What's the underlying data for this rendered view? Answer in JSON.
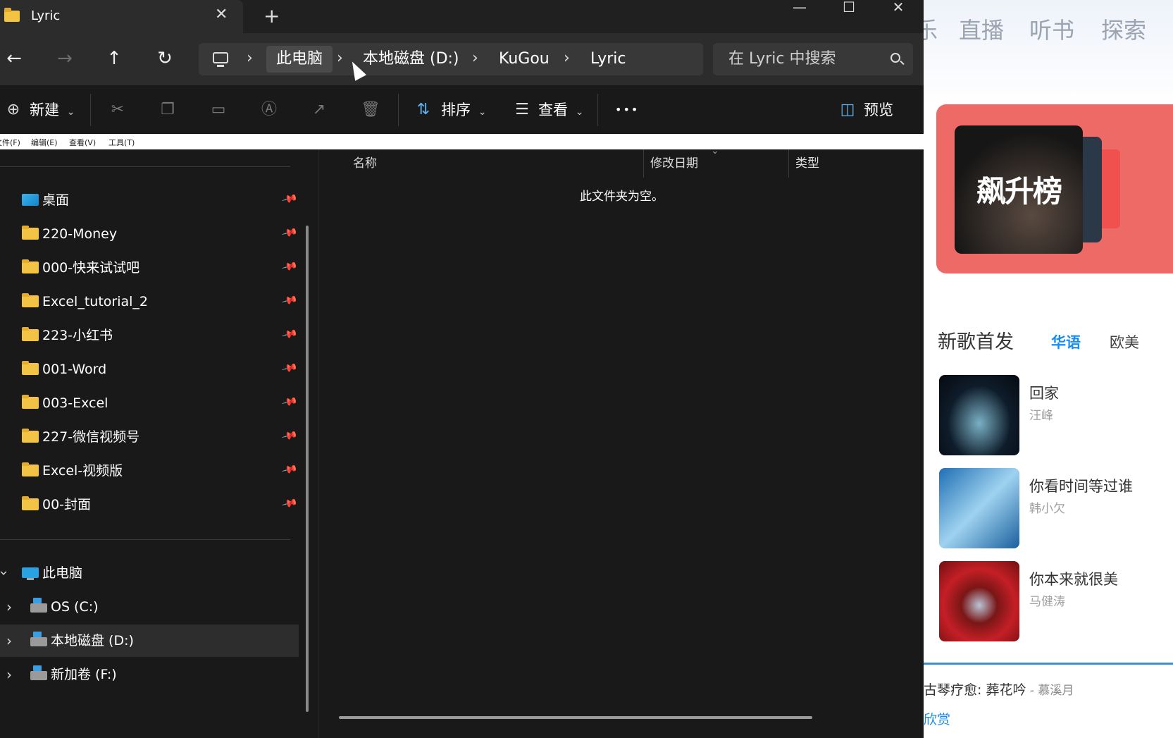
{
  "explorer": {
    "tab_title": "Lyric",
    "tab_close": "✕",
    "tab_add": "+",
    "win_min": "—",
    "win_max": "☐",
    "win_close": "✕",
    "address": {
      "segments": [
        "此电脑",
        "本地磁盘 (D:)",
        "KuGou",
        "Lyric"
      ],
      "chevron": "›"
    },
    "search_placeholder": "在 Lyric 中搜索",
    "nav_icons": {
      "back": "←",
      "forward": "→",
      "up": "↑",
      "refresh": "↻"
    },
    "toolbar": {
      "new_label": "新建",
      "sort_label": "排序",
      "view_label": "查看",
      "more_label": "•••",
      "preview_label": "预览",
      "caret": "⌄"
    },
    "menubar": [
      "文件(F)",
      "编辑(E)",
      "查看(V)",
      "工具(T)"
    ],
    "sidebar": {
      "quick_access": [
        {
          "label": "桌面",
          "icon": "desktop-icon"
        },
        {
          "label": "220-Money",
          "icon": "folder-icon"
        },
        {
          "label": "000-快来试试吧",
          "icon": "folder-icon"
        },
        {
          "label": "Excel_tutorial_2",
          "icon": "folder-icon"
        },
        {
          "label": "223-小红书",
          "icon": "folder-icon"
        },
        {
          "label": "001-Word",
          "icon": "folder-icon"
        },
        {
          "label": "003-Excel",
          "icon": "folder-icon"
        },
        {
          "label": "227-微信视频号",
          "icon": "folder-icon"
        },
        {
          "label": "Excel-视频版",
          "icon": "folder-icon"
        },
        {
          "label": "00-封面",
          "icon": "folder-icon"
        }
      ],
      "this_pc": "此电脑",
      "drives": [
        "OS (C:)",
        "本地磁盘 (D:)",
        "新加卷 (F:)"
      ],
      "pin_glyph": "📌"
    },
    "columns": {
      "name": "名称",
      "modified": "修改日期",
      "type": "类型"
    },
    "empty_message": "此文件夹为空。"
  },
  "kugou": {
    "nav": [
      "乐",
      "直播",
      "听书",
      "探索"
    ],
    "banner_title": "飙升榜",
    "section_title": "新歌首发",
    "tabs": [
      "华语",
      "欧美"
    ],
    "songs": [
      {
        "title": "回家",
        "artist": "汪峰"
      },
      {
        "title": "你看时间等过谁",
        "artist": "韩小欠"
      },
      {
        "title": "你本来就很美",
        "artist": "马健涛"
      }
    ],
    "now_playing_title": "古琴疗愈: 葬花吟",
    "now_playing_artist": " - 慕溪月",
    "now_playing_sub": "欣赏"
  }
}
